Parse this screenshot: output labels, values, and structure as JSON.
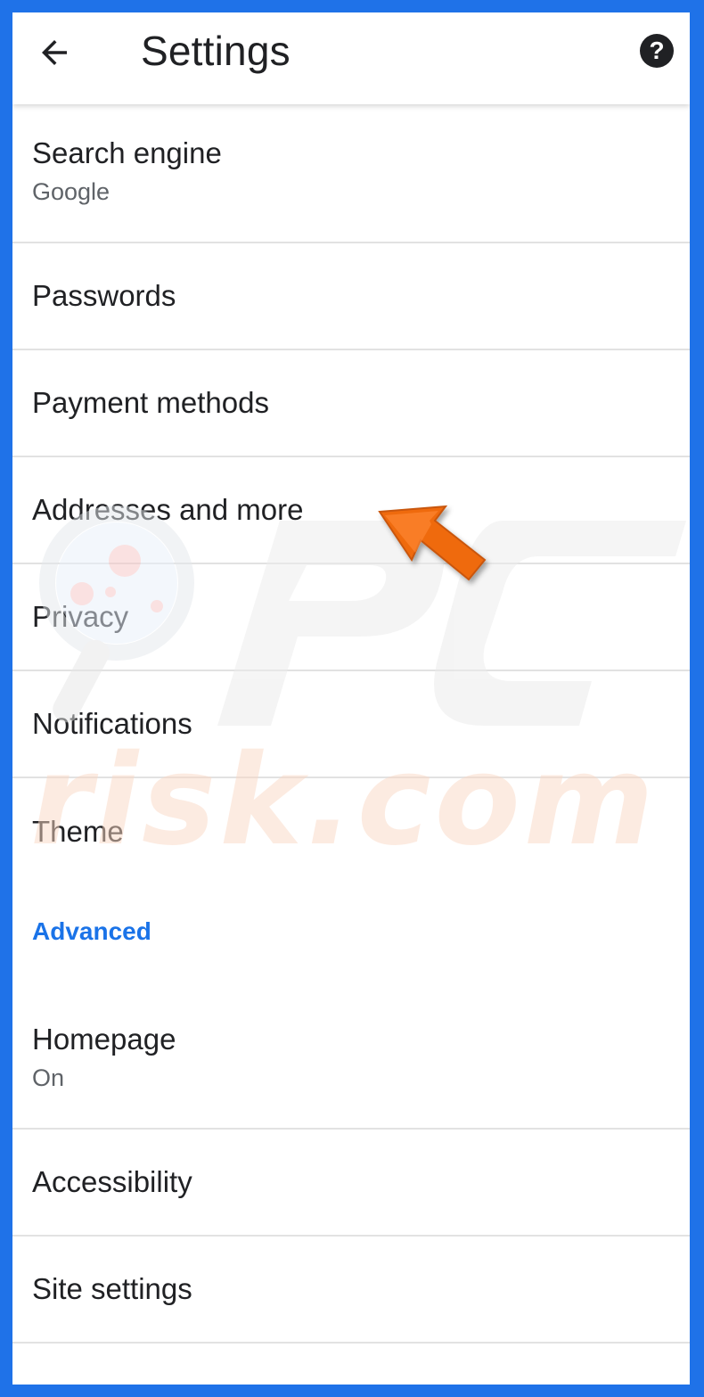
{
  "app_bar": {
    "title": "Settings",
    "back_icon": "arrow-back-icon",
    "help_icon": "help-icon",
    "help_glyph": "?"
  },
  "settings": {
    "search_engine": {
      "label": "Search engine",
      "value": "Google"
    },
    "passwords": {
      "label": "Passwords"
    },
    "payment_methods": {
      "label": "Payment methods"
    },
    "addresses": {
      "label": "Addresses and more"
    },
    "privacy": {
      "label": "Privacy"
    },
    "notifications": {
      "label": "Notifications"
    },
    "theme": {
      "label": "Theme"
    },
    "advanced_header": "Advanced",
    "homepage": {
      "label": "Homepage",
      "value": "On"
    },
    "accessibility": {
      "label": "Accessibility"
    },
    "site_settings": {
      "label": "Site settings"
    }
  },
  "watermark": {
    "brand_text": "PC risk.com"
  },
  "colors": {
    "frame_border": "#1f72e8",
    "accent": "#1a73e8",
    "arrow": "#ef6a0c"
  }
}
